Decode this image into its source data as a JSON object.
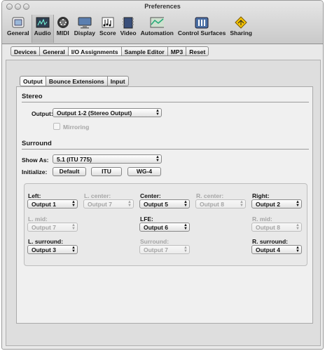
{
  "window": {
    "title": "Preferences"
  },
  "toolbar": {
    "items": [
      {
        "label": "General",
        "icon": "general-icon"
      },
      {
        "label": "Audio",
        "icon": "audio-icon"
      },
      {
        "label": "MIDI",
        "icon": "midi-icon"
      },
      {
        "label": "Display",
        "icon": "display-icon"
      },
      {
        "label": "Score",
        "icon": "score-icon"
      },
      {
        "label": "Video",
        "icon": "video-icon"
      },
      {
        "label": "Automation",
        "icon": "automation-icon"
      },
      {
        "label": "Control Surfaces",
        "icon": "control-surfaces-icon"
      },
      {
        "label": "Sharing",
        "icon": "sharing-icon"
      }
    ],
    "active": "Audio"
  },
  "subtabs": {
    "items": [
      "Devices",
      "General",
      "I/O Assignments",
      "Sample Editor",
      "MP3",
      "Reset"
    ],
    "active": "I/O Assignments"
  },
  "innertabs": {
    "items": [
      "Output",
      "Bounce Extensions",
      "Input"
    ],
    "active": "Output"
  },
  "stereo": {
    "title": "Stereo",
    "output_label": "Output:",
    "output_value": "Output 1-2  (Stereo Output)",
    "mirroring_label": "Mirroring"
  },
  "surround": {
    "title": "Surround",
    "show_as_label": "Show As:",
    "show_as_value": "5.1 (ITU 775)",
    "initialize_label": "Initialize:",
    "buttons": {
      "default": "Default",
      "itu": "ITU",
      "wg4": "WG-4"
    },
    "channels": {
      "left": {
        "label": "Left:",
        "value": "Output 1"
      },
      "l_center": {
        "label": "L. center:",
        "value": "Output 7"
      },
      "center": {
        "label": "Center:",
        "value": "Output 5"
      },
      "r_center": {
        "label": "R. center:",
        "value": "Output 8"
      },
      "right": {
        "label": "Right:",
        "value": "Output 2"
      },
      "l_mid": {
        "label": "L. mid:",
        "value": "Output 7"
      },
      "lfe": {
        "label": "LFE:",
        "value": "Output 6"
      },
      "r_mid": {
        "label": "R. mid:",
        "value": "Output 8"
      },
      "l_surround": {
        "label": "L. surround:",
        "value": "Output 3"
      },
      "surround": {
        "label": "Surround:",
        "value": "Output 7"
      },
      "r_surround": {
        "label": "R. surround:",
        "value": "Output 4"
      }
    }
  }
}
